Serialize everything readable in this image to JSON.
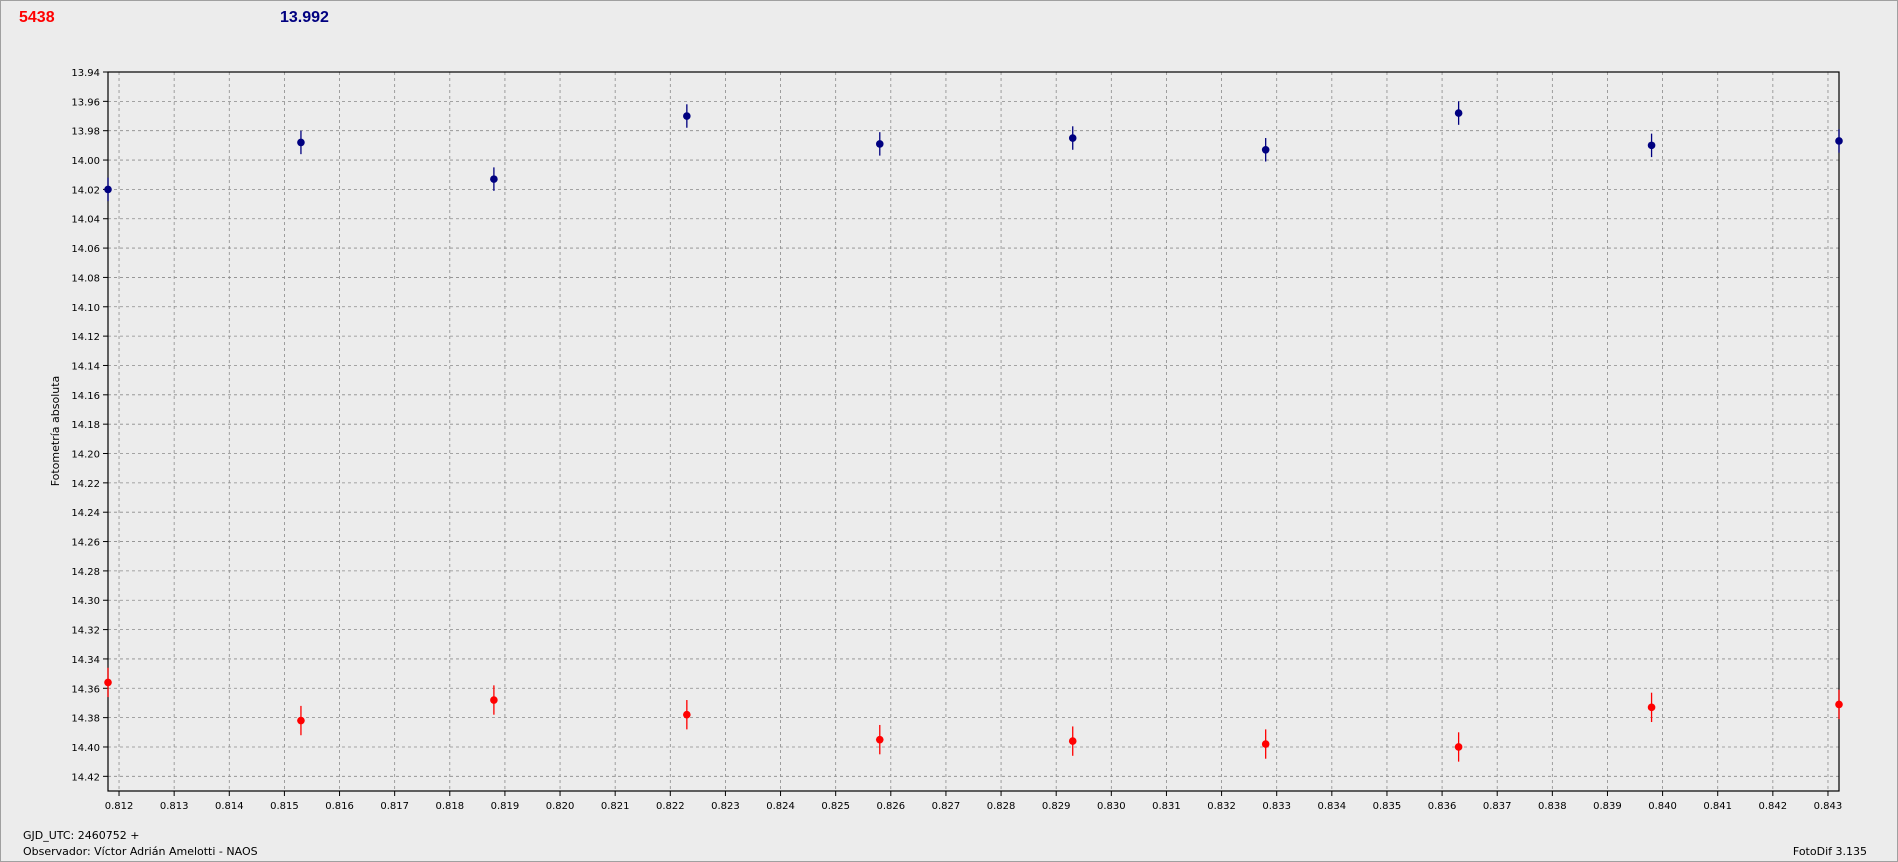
{
  "header": {
    "left_value": "5438",
    "right_value": "13.992",
    "left_color": "#ff0000",
    "right_color": "#000080"
  },
  "footer": {
    "gjd": "GJD_UTC: 2460752 +",
    "observer": "Observador: Víctor Adrián Amelotti - NAOS",
    "software": "FotoDif 3.135"
  },
  "chart_data": {
    "type": "scatter",
    "title": "",
    "xlabel": "",
    "ylabel": "Fotometría absoluta",
    "xlim": [
      0.8118,
      0.8432
    ],
    "ylim": [
      13.94,
      14.43
    ],
    "y_inverted": true,
    "grid": true,
    "x_ticks": [
      "0.812",
      "0.813",
      "0.814",
      "0.815",
      "0.816",
      "0.817",
      "0.818",
      "0.819",
      "0.820",
      "0.821",
      "0.822",
      "0.823",
      "0.824",
      "0.825",
      "0.826",
      "0.827",
      "0.828",
      "0.829",
      "0.830",
      "0.831",
      "0.832",
      "0.833",
      "0.834",
      "0.835",
      "0.836",
      "0.837",
      "0.838",
      "0.839",
      "0.840",
      "0.841",
      "0.842",
      "0.843"
    ],
    "y_ticks": [
      "13.94",
      "13.96",
      "13.98",
      "14.00",
      "14.02",
      "14.04",
      "14.06",
      "14.08",
      "14.10",
      "14.12",
      "14.14",
      "14.16",
      "14.18",
      "14.20",
      "14.22",
      "14.24",
      "14.26",
      "14.28",
      "14.30",
      "14.32",
      "14.34",
      "14.36",
      "14.38",
      "14.40",
      "14.42"
    ],
    "series": [
      {
        "color": "#000080",
        "x": [
          0.8118,
          0.8153,
          0.8188,
          0.8223,
          0.8258,
          0.8293,
          0.8328,
          0.8363,
          0.8398,
          0.8432
        ],
        "y": [
          14.02,
          13.988,
          14.013,
          13.97,
          13.989,
          13.985,
          13.993,
          13.968,
          13.99,
          13.987
        ],
        "err": [
          0.008,
          0.008,
          0.008,
          0.008,
          0.008,
          0.008,
          0.008,
          0.008,
          0.008,
          0.008
        ]
      },
      {
        "color": "#ff0000",
        "x": [
          0.8118,
          0.8153,
          0.8188,
          0.8223,
          0.8258,
          0.8293,
          0.8328,
          0.8363,
          0.8398,
          0.8432
        ],
        "y": [
          14.356,
          14.382,
          14.368,
          14.378,
          14.395,
          14.396,
          14.398,
          14.4,
          14.373,
          14.371
        ],
        "err": [
          0.01,
          0.01,
          0.01,
          0.01,
          0.01,
          0.01,
          0.01,
          0.01,
          0.01,
          0.01
        ]
      }
    ]
  }
}
